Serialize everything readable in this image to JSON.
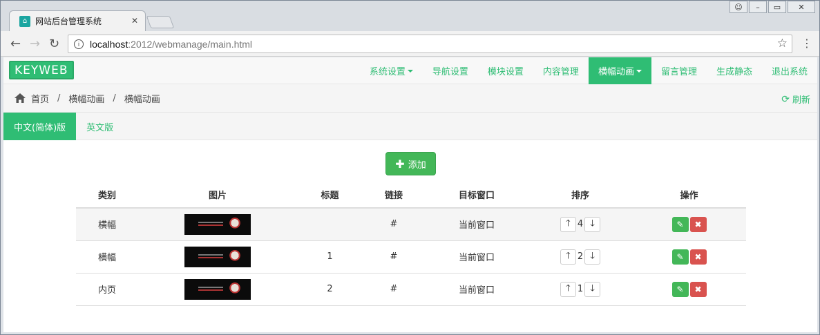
{
  "browser": {
    "tab_title": "网站后台管理系统",
    "tab_favicon": "house-favicon",
    "url_host": "localhost",
    "url_path": ":2012/webmanage/main.html"
  },
  "navbar": {
    "logo": "KEYWEB",
    "menu": [
      {
        "label": "系统设置",
        "dropdown": true,
        "active": false
      },
      {
        "label": "导航设置",
        "dropdown": false,
        "active": false
      },
      {
        "label": "模块设置",
        "dropdown": false,
        "active": false
      },
      {
        "label": "内容管理",
        "dropdown": false,
        "active": false
      },
      {
        "label": "横幅动画",
        "dropdown": true,
        "active": true
      },
      {
        "label": "留言管理",
        "dropdown": false,
        "active": false
      },
      {
        "label": "生成静态",
        "dropdown": false,
        "active": false
      },
      {
        "label": "退出系统",
        "dropdown": false,
        "active": false
      }
    ]
  },
  "breadcrumb": {
    "items": [
      "首页",
      "横幅动画",
      "横幅动画"
    ],
    "refresh_label": "刷新"
  },
  "lang_tabs": [
    {
      "label": "中文(简体)版",
      "active": true
    },
    {
      "label": "英文版",
      "active": false
    }
  ],
  "add_button": "添加",
  "table": {
    "headers": [
      "类别",
      "图片",
      "标题",
      "链接",
      "目标窗口",
      "排序",
      "操作"
    ],
    "rows": [
      {
        "category": "横幅",
        "title": "",
        "link": "#",
        "target": "当前窗口",
        "sort": "4"
      },
      {
        "category": "横幅",
        "title": "1",
        "link": "#",
        "target": "当前窗口",
        "sort": "2"
      },
      {
        "category": "内页",
        "title": "2",
        "link": "#",
        "target": "当前窗口",
        "sort": "1"
      }
    ]
  },
  "colors": {
    "accent": "#2fbd74",
    "add_button": "#43b758",
    "delete_button": "#d9534f"
  }
}
